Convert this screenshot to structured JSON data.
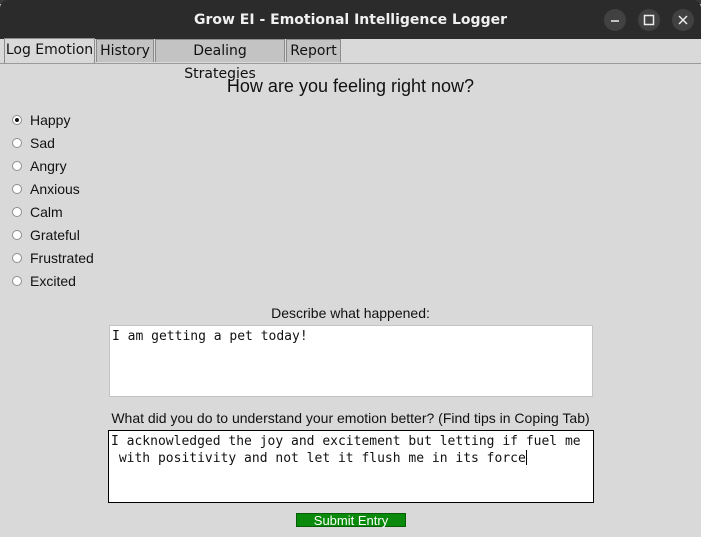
{
  "window": {
    "title": "Grow EI - Emotional Intelligence Logger"
  },
  "tabs": [
    {
      "label": "Log Emotion",
      "active": true
    },
    {
      "label": "History",
      "active": false
    },
    {
      "label": "Dealing Strategies",
      "active": false
    },
    {
      "label": "Report",
      "active": false
    }
  ],
  "form": {
    "heading": "How are you feeling right now?",
    "emotions": [
      {
        "label": "Happy",
        "selected": true
      },
      {
        "label": "Sad",
        "selected": false
      },
      {
        "label": "Angry",
        "selected": false
      },
      {
        "label": "Anxious",
        "selected": false
      },
      {
        "label": "Calm",
        "selected": false
      },
      {
        "label": "Grateful",
        "selected": false
      },
      {
        "label": "Frustrated",
        "selected": false
      },
      {
        "label": "Excited",
        "selected": false
      }
    ],
    "describe_label": "Describe what happened:",
    "describe_value": "I am getting a pet today!",
    "understand_label": "What did you do to understand your emotion better? (Find tips in Coping Tab)",
    "understand_value": "I acknowledged the joy and excitement but letting if fuel me\n with positivity and not let it flush me in its force",
    "submit_label": "Submit Entry"
  },
  "colors": {
    "titlebar": "#2b2b2b",
    "window_bg": "#d9d9d9",
    "submit_bg": "#0a8a0a"
  }
}
